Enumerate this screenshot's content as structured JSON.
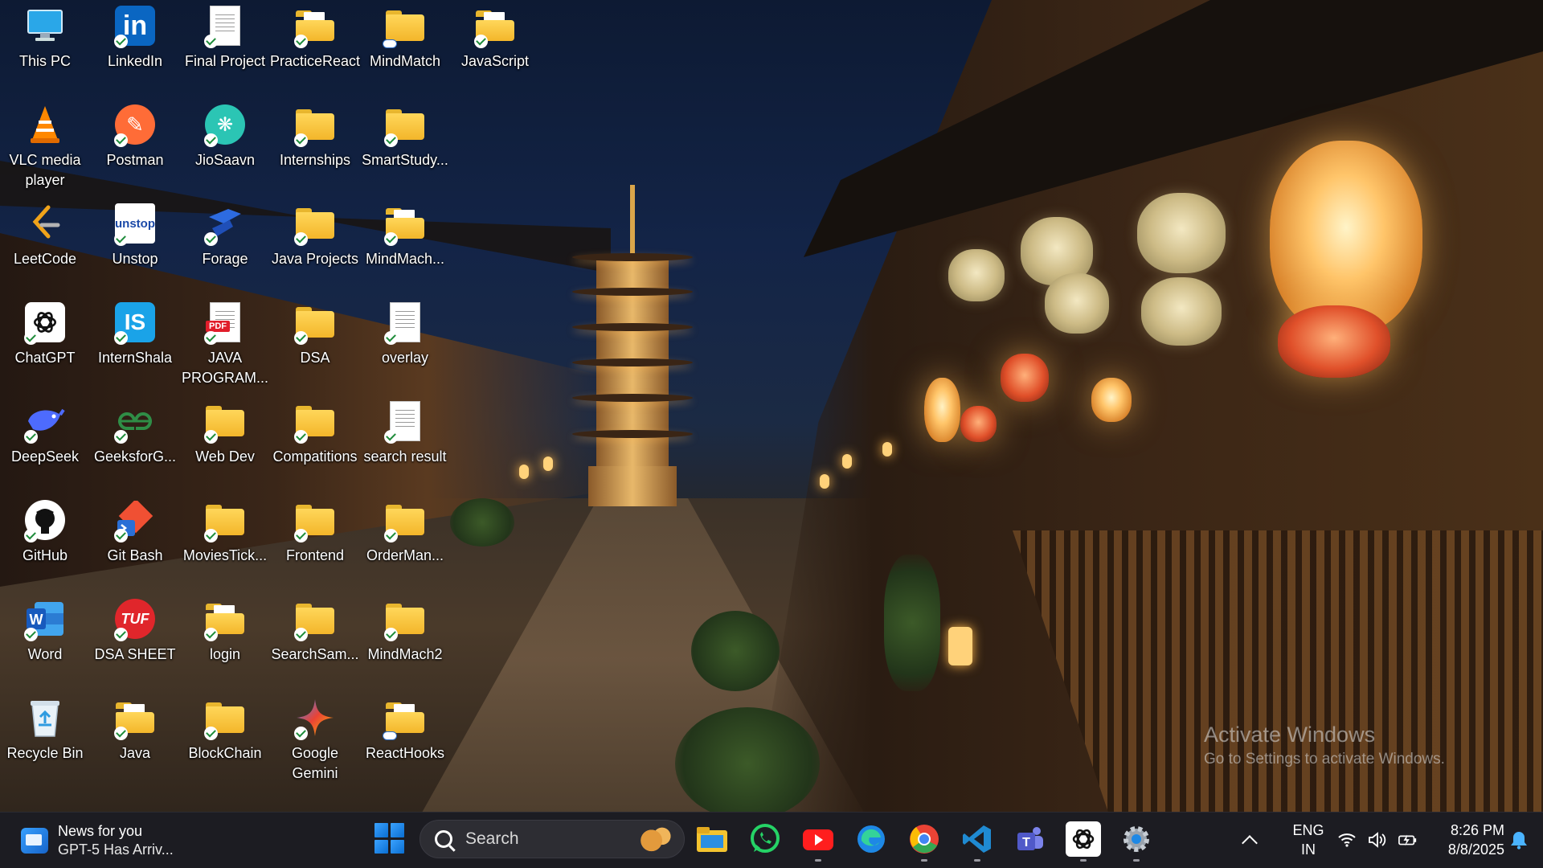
{
  "desktop": {
    "icons": [
      {
        "label": "This PC",
        "icon": "this-pc-icon"
      },
      {
        "label": "LinkedIn",
        "icon": "linkedin-icon"
      },
      {
        "label": "Final Project",
        "icon": "document-icon"
      },
      {
        "label": "PracticeReact",
        "icon": "folder-icon"
      },
      {
        "label": "MindMatch",
        "icon": "folder-icon"
      },
      {
        "label": "JavaScript",
        "icon": "folder-icon"
      },
      {
        "label": "VLC media player",
        "icon": "vlc-icon"
      },
      {
        "label": "Postman",
        "icon": "postman-icon"
      },
      {
        "label": "JioSaavn",
        "icon": "jiosaavn-icon"
      },
      {
        "label": "Internships",
        "icon": "folder-icon"
      },
      {
        "label": "SmartStudy...",
        "icon": "folder-icon"
      },
      {
        "label": "LeetCode",
        "icon": "leetcode-icon"
      },
      {
        "label": "Unstop",
        "icon": "unstop-icon"
      },
      {
        "label": "Forage",
        "icon": "forage-icon"
      },
      {
        "label": "Java Projects",
        "icon": "folder-icon"
      },
      {
        "label": "MindMach...",
        "icon": "folder-icon"
      },
      {
        "label": "ChatGPT",
        "icon": "chatgpt-icon"
      },
      {
        "label": "InternShala",
        "icon": "internshala-icon"
      },
      {
        "label": "JAVA PROGRAM...",
        "icon": "pdf-icon"
      },
      {
        "label": "DSA",
        "icon": "folder-icon"
      },
      {
        "label": "overlay",
        "icon": "document-icon"
      },
      {
        "label": "DeepSeek",
        "icon": "deepseek-icon"
      },
      {
        "label": "GeeksforG...",
        "icon": "geeksforgeeks-icon"
      },
      {
        "label": "Web Dev",
        "icon": "folder-icon"
      },
      {
        "label": "Compatitions",
        "icon": "folder-icon"
      },
      {
        "label": "search result",
        "icon": "document-icon"
      },
      {
        "label": "GitHub",
        "icon": "github-icon"
      },
      {
        "label": "Git Bash",
        "icon": "git-bash-icon"
      },
      {
        "label": "MoviesTick...",
        "icon": "folder-icon"
      },
      {
        "label": "Frontend",
        "icon": "folder-icon"
      },
      {
        "label": "OrderMan...",
        "icon": "folder-icon"
      },
      {
        "label": "Word",
        "icon": "word-icon"
      },
      {
        "label": "DSA SHEET",
        "icon": "tuf-icon"
      },
      {
        "label": "login",
        "icon": "folder-icon"
      },
      {
        "label": "SearchSam...",
        "icon": "folder-icon"
      },
      {
        "label": "MindMach2",
        "icon": "folder-icon"
      },
      {
        "label": "Recycle Bin",
        "icon": "recycle-bin-icon"
      },
      {
        "label": "Java",
        "icon": "folder-icon"
      },
      {
        "label": "BlockChain",
        "icon": "folder-icon"
      },
      {
        "label": "Google Gemini",
        "icon": "gemini-icon"
      },
      {
        "label": "ReactHooks",
        "icon": "folder-icon"
      }
    ],
    "watermark": {
      "title": "Activate Windows",
      "subtitle": "Go to Settings to activate Windows."
    }
  },
  "taskbar": {
    "news": {
      "title": "News for you",
      "headline": "GPT-5 Has Arriv..."
    },
    "search_placeholder": "Search",
    "pinned_apps": [
      "file-explorer-icon",
      "whatsapp-icon",
      "youtube-icon",
      "edge-icon",
      "chrome-icon",
      "vscode-icon",
      "teams-icon",
      "chatgpt-icon",
      "settings-icon"
    ],
    "tray": {
      "language": "ENG",
      "region": "IN",
      "time": "8:26 PM",
      "date": "8/8/2025"
    }
  },
  "colors": {
    "taskbar_bg": "#1c1c22",
    "folder_yellow": "#f3b62a",
    "accent_blue": "#0a6ed1"
  }
}
